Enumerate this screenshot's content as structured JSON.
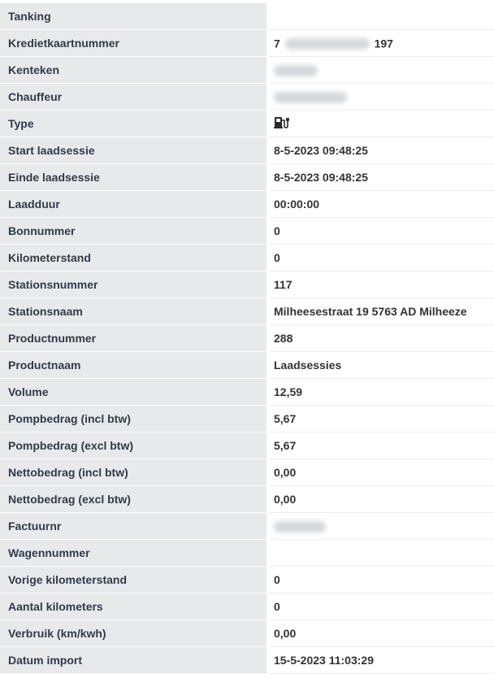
{
  "rows": [
    {
      "label": "Tanking",
      "value": ""
    },
    {
      "label": "Kredietkaartnummer",
      "value_prefix": "7",
      "value_suffix": "197"
    },
    {
      "label": "Kenteken",
      "value": ""
    },
    {
      "label": "Chauffeur",
      "value": ""
    },
    {
      "label": "Type",
      "icon": "ev-charging-station-icon"
    },
    {
      "label": "Start laadsessie",
      "value": "8-5-2023 09:48:25"
    },
    {
      "label": "Einde laadsessie",
      "value": "8-5-2023 09:48:25"
    },
    {
      "label": "Laadduur",
      "value": "00:00:00"
    },
    {
      "label": "Bonnummer",
      "value": "0"
    },
    {
      "label": "Kilometerstand",
      "value": "0"
    },
    {
      "label": "Stationsnummer",
      "value": "117"
    },
    {
      "label": "Stationsnaam",
      "value": "Milheesestraat 19 5763 AD Milheeze"
    },
    {
      "label": "Productnummer",
      "value": "288"
    },
    {
      "label": "Productnaam",
      "value": "Laadsessies"
    },
    {
      "label": "Volume",
      "value": "12,59"
    },
    {
      "label": "Pompbedrag (incl btw)",
      "value": "5,67"
    },
    {
      "label": "Pompbedrag (excl btw)",
      "value": "5,67"
    },
    {
      "label": "Nettobedrag (incl btw)",
      "value": "0,00"
    },
    {
      "label": "Nettobedrag (excl btw)",
      "value": "0,00"
    },
    {
      "label": "Factuurnr",
      "value": ""
    },
    {
      "label": "Wagennummer",
      "value": ""
    },
    {
      "label": "Vorige kilometerstand",
      "value": "0"
    },
    {
      "label": "Aantal kilometers",
      "value": "0"
    },
    {
      "label": "Verbruik (km/kwh)",
      "value": "0,00"
    },
    {
      "label": "Datum import",
      "value": "15-5-2023 11:03:29"
    }
  ]
}
